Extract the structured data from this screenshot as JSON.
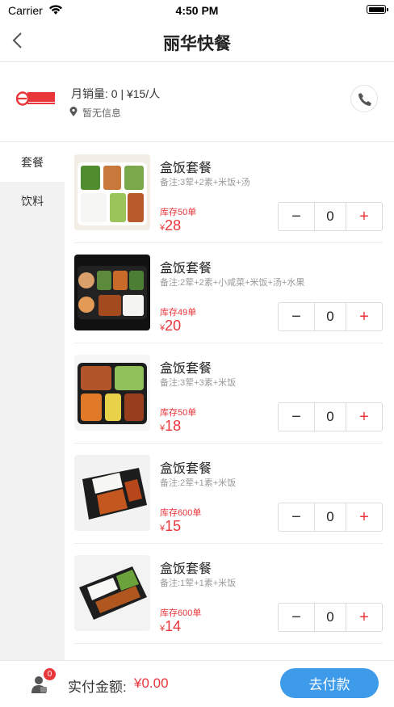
{
  "status_bar": {
    "carrier": "Carrier",
    "time": "4:50 PM"
  },
  "nav": {
    "title": "丽华快餐"
  },
  "shop": {
    "logo_text": "丽华快餐",
    "stats": "月销量: 0 | ¥15/人",
    "location": "暂无信息"
  },
  "categories": [
    {
      "label": "套餐",
      "active": true
    },
    {
      "label": "饮料",
      "active": false
    }
  ],
  "products": [
    {
      "name": "盒饭套餐",
      "note": "备注:3荤+2素+米饭+汤",
      "stock": "库存50单",
      "currency": "¥",
      "price": "28",
      "quantity": "0"
    },
    {
      "name": "盒饭套餐",
      "note": "备注:2荤+2素+小咸菜+米饭+汤+水果",
      "stock": "库存49单",
      "currency": "¥",
      "price": "20",
      "quantity": "0"
    },
    {
      "name": "盒饭套餐",
      "note": "备注:3荤+3素+米饭",
      "stock": "库存50单",
      "currency": "¥",
      "price": "18",
      "quantity": "0"
    },
    {
      "name": "盒饭套餐",
      "note": "备注:2荤+1素+米饭",
      "stock": "库存600单",
      "currency": "¥",
      "price": "15",
      "quantity": "0"
    },
    {
      "name": "盒饭套餐",
      "note": "备注:1荤+1素+米饭",
      "stock": "库存600单",
      "currency": "¥",
      "price": "14",
      "quantity": "0"
    }
  ],
  "stepper": {
    "minus": "−",
    "plus": "+"
  },
  "bottom": {
    "cart_count": "0",
    "pay_label": "实付金额:",
    "pay_amount": "¥0.00",
    "pay_button": "去付款"
  },
  "colors": {
    "accent_red": "#e8363a",
    "pay_blue": "#3d9be9",
    "sidebar_bg": "#f2f2f2"
  },
  "icons": [
    "wifi-icon",
    "battery-icon",
    "back-chevron-icon",
    "location-pin-icon",
    "phone-icon",
    "cart-user-icon"
  ]
}
